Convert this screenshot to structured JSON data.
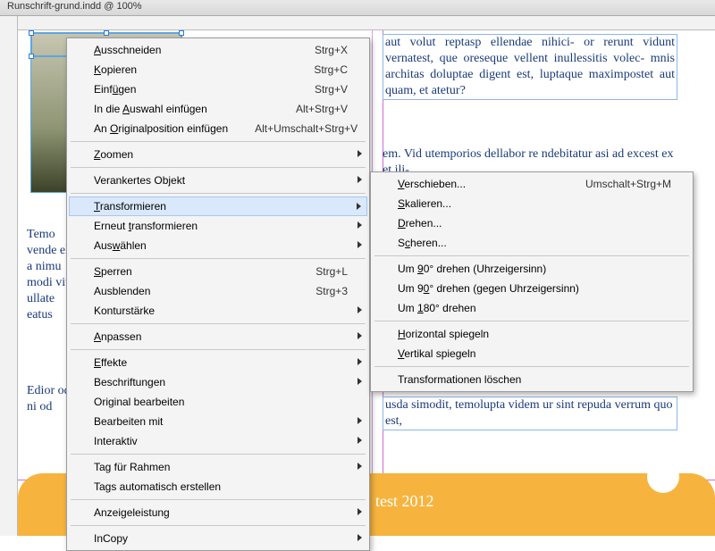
{
  "title": "Runschrift-grund.indd @ 100%",
  "canvasText": {
    "right1": "aut volut reptasp ellendae nihici-\nor rerunt vidunt vernatest, que\noreseque vellent inullessitis volec-\nmnis architas doluptae digent est,\nluptaque maximpostet aut quam,\net atetur?",
    "right2": "em. Vid utemporios dellabor re\nndebitatur asi ad excest ex et ili-",
    "right3": "usda simodit, temolupta videm\nur sint repuda verrum quo est,",
    "leftA": "Temo\nvende\nelit a\nnimu\nmodi\nvitae\nullate\neatus",
    "leftB": "Edior\nod e\nni od"
  },
  "footer": {
    "text": "test 2012"
  },
  "menu1": [
    {
      "label": "Ausschneiden",
      "u": 0,
      "shortcut": "Strg+X"
    },
    {
      "label": "Kopieren",
      "u": 0,
      "shortcut": "Strg+C"
    },
    {
      "label": "Einfügen",
      "u": 4,
      "shortcut": "Strg+V"
    },
    {
      "label": "In die Auswahl einfügen",
      "u": 7,
      "shortcut": "Alt+Strg+V"
    },
    {
      "label": "An Originalposition einfügen",
      "u": 3,
      "shortcut": "Alt+Umschalt+Strg+V"
    },
    {
      "sep": true
    },
    {
      "label": "Zoomen",
      "u": 0,
      "sub": true
    },
    {
      "sep": true
    },
    {
      "label": "Verankertes Objekt",
      "u": -1,
      "sub": true
    },
    {
      "sep": true
    },
    {
      "label": "Transformieren",
      "u": 0,
      "sub": true,
      "hover": true
    },
    {
      "label": "Erneut transformieren",
      "u": 7,
      "sub": true
    },
    {
      "label": "Auswählen",
      "u": 3,
      "sub": true
    },
    {
      "sep": true
    },
    {
      "label": "Sperren",
      "u": 0,
      "shortcut": "Strg+L"
    },
    {
      "label": "Ausblenden",
      "u": -1,
      "shortcut": "Strg+3"
    },
    {
      "label": "Konturstärke",
      "u": -1,
      "sub": true
    },
    {
      "sep": true
    },
    {
      "label": "Anpassen",
      "u": 0,
      "sub": true
    },
    {
      "sep": true
    },
    {
      "label": "Effekte",
      "u": 0,
      "sub": true
    },
    {
      "label": "Beschriftungen",
      "u": -1,
      "sub": true
    },
    {
      "label": "Original bearbeiten",
      "u": -1
    },
    {
      "label": "Bearbeiten mit",
      "u": -1,
      "sub": true
    },
    {
      "label": "Interaktiv",
      "u": -1,
      "sub": true
    },
    {
      "sep": true
    },
    {
      "label": "Tag für Rahmen",
      "u": -1,
      "sub": true
    },
    {
      "label": "Tags automatisch erstellen",
      "u": -1
    },
    {
      "sep": true
    },
    {
      "label": "Anzeigeleistung",
      "u": -1,
      "sub": true
    },
    {
      "sep": true
    },
    {
      "label": "InCopy",
      "u": -1,
      "sub": true
    }
  ],
  "menu2": [
    {
      "label": "Verschieben...",
      "u": 0,
      "shortcut": "Umschalt+Strg+M"
    },
    {
      "label": "Skalieren...",
      "u": 0
    },
    {
      "label": "Drehen...",
      "u": 0
    },
    {
      "label": "Scheren...",
      "u": 1
    },
    {
      "sep": true
    },
    {
      "label": "Um 90° drehen (Uhrzeigersinn)",
      "u": 3
    },
    {
      "label": "Um 90° drehen (gegen Uhrzeigersinn)",
      "u": 4
    },
    {
      "label": "Um 180° drehen",
      "u": 3
    },
    {
      "sep": true
    },
    {
      "label": "Horizontal spiegeln",
      "u": 0
    },
    {
      "label": "Vertikal spiegeln",
      "u": 0
    },
    {
      "sep": true
    },
    {
      "label": "Transformationen löschen",
      "u": -1
    }
  ]
}
